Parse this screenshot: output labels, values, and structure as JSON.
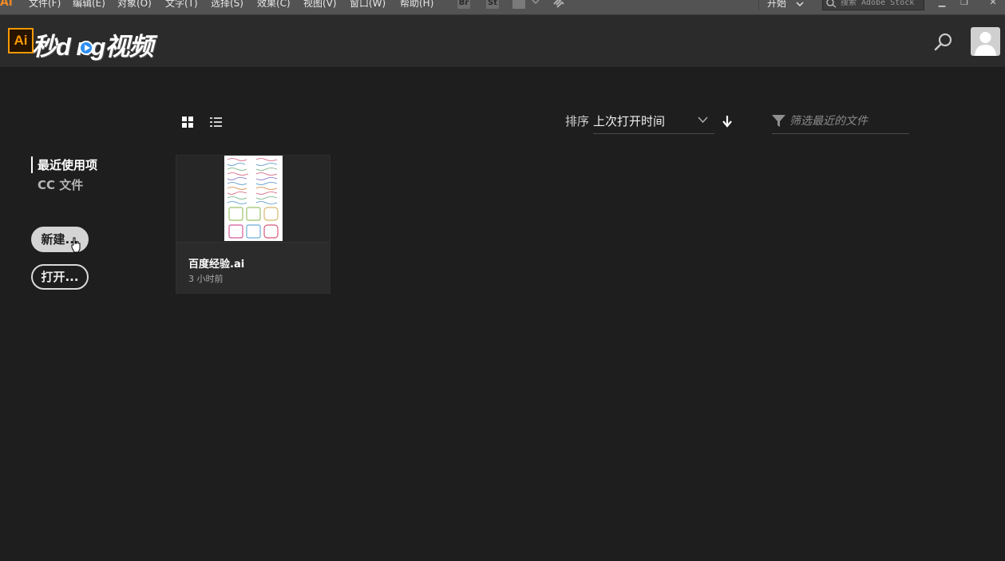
{
  "menubar": {
    "app_logo": "Ai",
    "items": [
      "文件(F)",
      "编辑(E)",
      "对象(O)",
      "文字(T)",
      "选择(S)",
      "效果(C)",
      "视图(V)",
      "窗口(W)",
      "帮助(H)"
    ],
    "bridge_icon": "Br",
    "stock_icon": "St",
    "workspace": "开始",
    "stock_search_placeholder": "搜索 Adobe Stock"
  },
  "header": {
    "brand_ai": "Ai",
    "brand_text": "秒d ng视频",
    "accent_color": "#ff9a00"
  },
  "sidebar": {
    "nav": [
      "最近使用项",
      "CC 文件"
    ],
    "new_button": "新建...",
    "open_button": "打开..."
  },
  "toolbar": {
    "sort_label": "排序",
    "sort_value": "上次打开时间",
    "filter_placeholder": "筛选最近的文件"
  },
  "files": [
    {
      "name": "百度经验.ai",
      "time": "3 小时前"
    }
  ]
}
